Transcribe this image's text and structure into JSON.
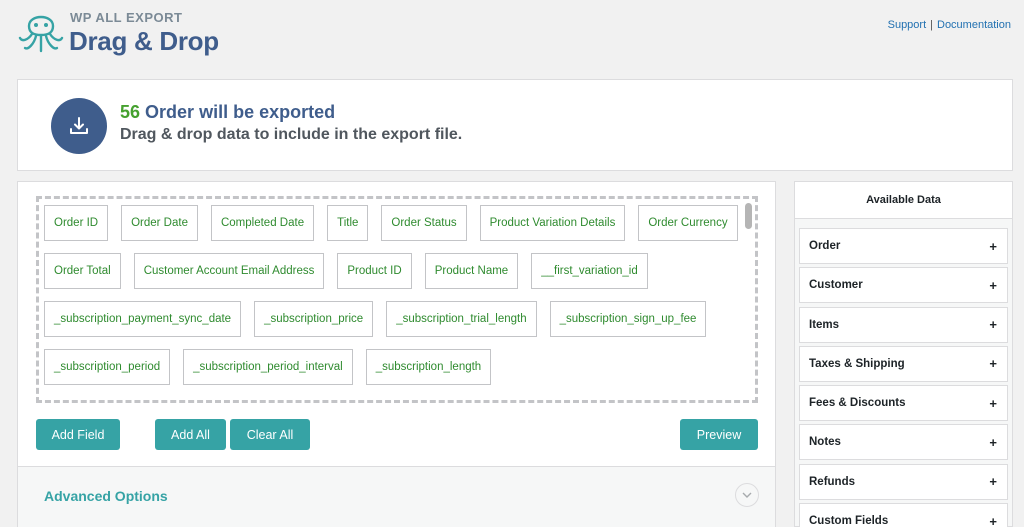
{
  "header": {
    "brand_small": "WP ALL EXPORT",
    "brand_big": "Drag & Drop",
    "support_label": "Support",
    "documentation_label": "Documentation"
  },
  "summary": {
    "count": "56",
    "count_text": "Order will be exported",
    "subtitle": "Drag & drop data to include in the export file."
  },
  "fields": [
    "Order ID",
    "Order Date",
    "Completed Date",
    "Title",
    "Order Status",
    "Product Variation Details",
    "Order Currency",
    "Order Total",
    "Customer Account Email Address",
    "Product ID",
    "Product Name",
    "__first_variation_id",
    "_subscription_payment_sync_date",
    "_subscription_price",
    "_subscription_trial_length",
    "_subscription_sign_up_fee",
    "_subscription_period",
    "_subscription_period_interval",
    "_subscription_length"
  ],
  "buttons": {
    "add_field": "Add Field",
    "add_all": "Add All",
    "clear_all": "Clear All",
    "preview": "Preview"
  },
  "advanced_options_label": "Advanced Options",
  "available_data": {
    "title": "Available Data",
    "items": [
      {
        "label": "Order"
      },
      {
        "label": "Customer"
      },
      {
        "label": "Items"
      },
      {
        "label": "Taxes & Shipping"
      },
      {
        "label": "Fees & Discounts"
      },
      {
        "label": "Notes"
      },
      {
        "label": "Refunds"
      },
      {
        "label": "Custom Fields"
      }
    ],
    "expand_symbol": "+"
  },
  "colors": {
    "brand_blue": "#3f5d8c",
    "count_green": "#46a12f",
    "field_green": "#2f8b2f",
    "teal_button": "#36a3a5"
  },
  "icons": [
    "octopus-logo-icon",
    "download-icon",
    "chevron-down-icon"
  ]
}
